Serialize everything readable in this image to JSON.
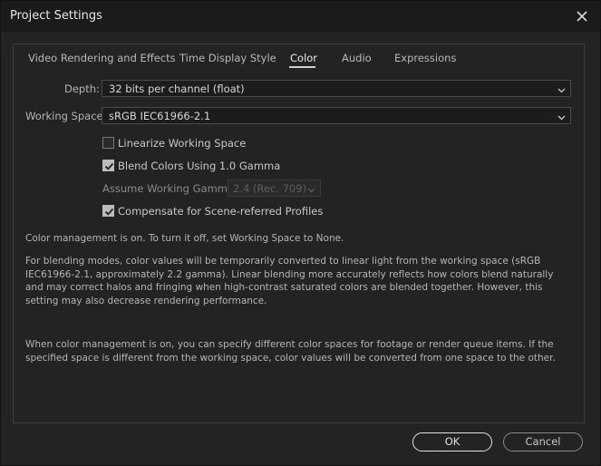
{
  "window": {
    "title": "Project Settings"
  },
  "tabs": [
    {
      "label": "Video Rendering and Effects",
      "active": false
    },
    {
      "label": "Time Display Style",
      "active": false
    },
    {
      "label": "Color",
      "active": true
    },
    {
      "label": "Audio",
      "active": false
    },
    {
      "label": "Expressions",
      "active": false
    }
  ],
  "color": {
    "depth_label": "Depth:",
    "depth_value": "32 bits per channel (float)",
    "working_space_label": "Working Space:",
    "working_space_value": "sRGB IEC61966-2.1",
    "linearize": {
      "label": "Linearize Working Space",
      "checked": false
    },
    "blend": {
      "label": "Blend Colors Using 1.0 Gamma",
      "checked": true
    },
    "gamma_label": "Assume Working Gamma:",
    "gamma_value": "2.4 (Rec. 709)",
    "compensate": {
      "label": "Compensate for Scene-referred Profiles",
      "checked": true
    },
    "info_1": "Color management is on. To turn it off, set Working Space to None.",
    "info_2": "For blending modes, color values will be temporarily converted to linear light from the working space (sRGB IEC61966-2.1, approximately 2.2 gamma). Linear blending more accurately reflects how colors blend naturally and may correct halos and fringing when high-contrast saturated colors are blended together. However, this setting may also decrease rendering performance.",
    "info_3": "When color management is on, you can specify different color spaces for footage or render queue items. If the specified space is different from the working space, color values will be converted from one space to the other."
  },
  "buttons": {
    "ok": "OK",
    "cancel": "Cancel"
  },
  "icons": {
    "close": "close-icon",
    "dropdown": "chevron-down-icon",
    "check": "checkmark-icon"
  },
  "colors": {
    "background": "#232323",
    "titlebar": "#1b1b1b",
    "text": "#c8c8c8"
  }
}
